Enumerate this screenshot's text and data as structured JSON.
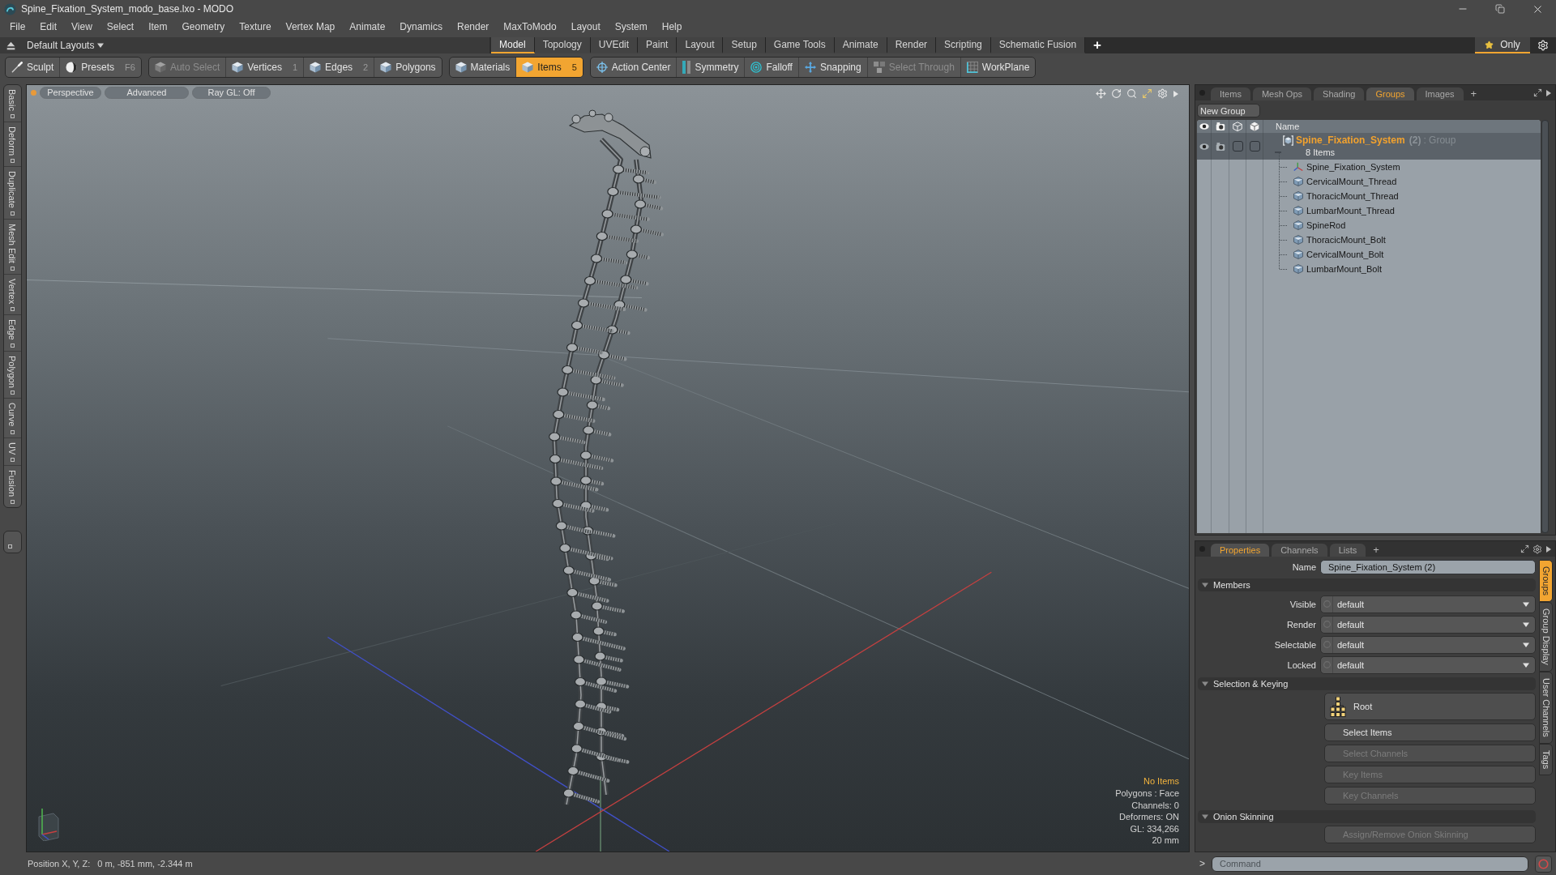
{
  "window": {
    "title": "Spine_Fixation_System_modo_base.lxo - MODO"
  },
  "menu": [
    "File",
    "Edit",
    "View",
    "Select",
    "Item",
    "Geometry",
    "Texture",
    "Vertex Map",
    "Animate",
    "Dynamics",
    "Render",
    "MaxToModo",
    "Layout",
    "System",
    "Help"
  ],
  "layout_bar": {
    "layouts": "Default Layouts",
    "tabs": [
      {
        "label": "Model",
        "selected": true
      },
      {
        "label": "Topology",
        "selected": false
      },
      {
        "label": "UVEdit",
        "selected": false
      },
      {
        "label": "Paint",
        "selected": false
      },
      {
        "label": "Layout",
        "selected": false
      },
      {
        "label": "Setup",
        "selected": false
      },
      {
        "label": "Game Tools",
        "selected": false
      },
      {
        "label": "Animate",
        "selected": false
      },
      {
        "label": "Render",
        "selected": false
      },
      {
        "label": "Scripting",
        "selected": false
      },
      {
        "label": "Schematic Fusion",
        "selected": false
      }
    ],
    "add": "+",
    "only": {
      "label": "Only",
      "on": true
    }
  },
  "toolbar": {
    "groups": [
      {
        "tools": [
          {
            "label": "Sculpt",
            "kind": "brush",
            "selected": false,
            "disabled": false
          },
          {
            "label": "Presets",
            "shortcut": "F6",
            "kind": "sphere",
            "selected": false,
            "disabled": false
          }
        ]
      },
      {
        "tools": [
          {
            "label": "Auto Select",
            "kind": "cube",
            "selected": false,
            "disabled": true
          },
          {
            "label": "Vertices",
            "shortcut": "1",
            "kind": "cube",
            "selected": false,
            "disabled": false
          },
          {
            "label": "Edges",
            "shortcut": "2",
            "kind": "cube",
            "selected": false,
            "disabled": false
          },
          {
            "label": "Polygons",
            "kind": "cube",
            "selected": false,
            "disabled": false
          }
        ]
      },
      {
        "tools": [
          {
            "label": "Materials",
            "kind": "cube",
            "selected": false,
            "disabled": false
          },
          {
            "label": "Items",
            "shortcut": "5",
            "kind": "cube",
            "selected": true,
            "disabled": false
          }
        ]
      },
      {
        "tools": [
          {
            "label": "Action Center",
            "kind": "crosshair",
            "selected": false,
            "disabled": false
          },
          {
            "label": "Symmetry",
            "kind": "mirror",
            "selected": false,
            "disabled": false
          },
          {
            "label": "Falloff",
            "kind": "rings",
            "selected": false,
            "disabled": false
          },
          {
            "label": "Snapping",
            "kind": "cross",
            "selected": false,
            "disabled": false
          },
          {
            "label": "Select Through",
            "kind": "cubes",
            "selected": false,
            "disabled": true
          },
          {
            "label": "WorkPlane",
            "kind": "grid",
            "selected": false,
            "disabled": false
          }
        ]
      }
    ]
  },
  "tool_tabs": [
    "Basic",
    "Deform",
    "Duplicate",
    "Mesh Edit",
    "Vertex",
    "Edge",
    "Polygon",
    "Curve",
    "UV",
    "Fusion"
  ],
  "viewport": {
    "view_buttons": [
      "Perspective",
      "Advanced",
      "Ray GL: Off"
    ],
    "info_title": "No Items",
    "info": [
      "Polygons : Face",
      "Channels: 0",
      "Deformers: ON",
      "GL: 334,266",
      "20 mm"
    ]
  },
  "status_bar": {
    "label": "Position X, Y, Z:",
    "value": "0 m, -851 mm, -2.344 m"
  },
  "groups_panel": {
    "tabs": [
      {
        "label": "Items",
        "selected": false
      },
      {
        "label": "Mesh Ops",
        "selected": false
      },
      {
        "label": "Shading",
        "selected": false
      },
      {
        "label": "Groups",
        "selected": true
      },
      {
        "label": "Images",
        "selected": false
      }
    ],
    "add": "+",
    "new_group": "New Group",
    "name_header": "Name",
    "group": {
      "name": "Spine_Fixation_System",
      "count": "(2)",
      "type": ": Group",
      "summary": "8 Items",
      "selected": true,
      "expanded": true,
      "toggles": [
        {
          "kind": "eye",
          "on": true
        },
        {
          "kind": "camera",
          "on": true
        },
        {
          "kind": "wireframe",
          "on": false
        },
        {
          "kind": "solid",
          "on": false
        }
      ],
      "children": [
        {
          "name": "Spine_Fixation_System",
          "kind": "locator"
        },
        {
          "name": "CervicalMount_Thread",
          "kind": "mesh"
        },
        {
          "name": "ThoracicMount_Thread",
          "kind": "mesh"
        },
        {
          "name": "LumbarMount_Thread",
          "kind": "mesh"
        },
        {
          "name": "SpineRod",
          "kind": "mesh"
        },
        {
          "name": "ThoracicMount_Bolt",
          "kind": "mesh"
        },
        {
          "name": "CervicalMount_Bolt",
          "kind": "mesh"
        },
        {
          "name": "LumbarMount_Bolt",
          "kind": "mesh"
        }
      ]
    }
  },
  "properties_panel": {
    "tabs": [
      {
        "label": "Properties",
        "selected": true
      },
      {
        "label": "Channels",
        "selected": false
      },
      {
        "label": "Lists",
        "selected": false
      }
    ],
    "add": "+",
    "name_label": "Name",
    "name_value": "Spine_Fixation_System (2)",
    "sections": [
      {
        "title": "Members",
        "kind": "dropdowns",
        "expanded": true,
        "rows": [
          {
            "label": "Visible",
            "value": "default"
          },
          {
            "label": "Render",
            "value": "default"
          },
          {
            "label": "Selectable",
            "value": "default"
          },
          {
            "label": "Locked",
            "value": "default"
          }
        ]
      },
      {
        "title": "Selection & Keying",
        "kind": "buttons",
        "expanded": true,
        "buttons": [
          {
            "label": "Root",
            "kind": "hierarchy",
            "disabled": false
          },
          {
            "label": "Select Items",
            "kind": "plain",
            "disabled": false
          },
          {
            "label": "Select Channels",
            "kind": "plain",
            "disabled": true
          },
          {
            "label": "Key Items",
            "kind": "plain",
            "disabled": true
          },
          {
            "label": "Key Channels",
            "kind": "plain",
            "disabled": true
          }
        ]
      },
      {
        "title": "Onion Skinning",
        "kind": "buttons",
        "expanded": true,
        "buttons": [
          {
            "label": "Assign/Remove Onion Skinning",
            "kind": "plain",
            "disabled": true
          }
        ]
      }
    ],
    "side_tabs": [
      {
        "label": "Groups",
        "selected": true
      },
      {
        "label": "Group Display",
        "selected": false
      },
      {
        "label": "User Channels",
        "selected": false
      },
      {
        "label": "Tags",
        "selected": false
      }
    ]
  },
  "command": {
    "prompt": ">",
    "placeholder": "Command"
  }
}
